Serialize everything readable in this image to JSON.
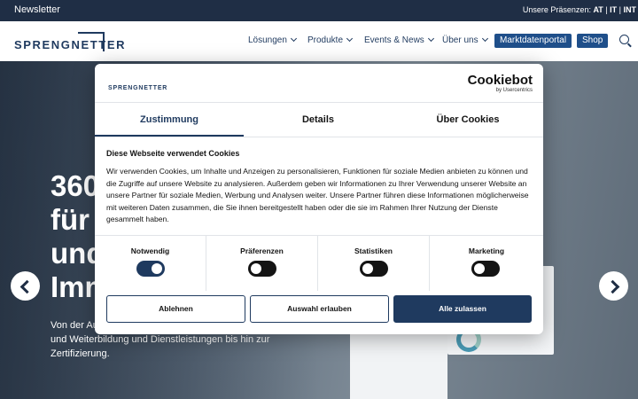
{
  "topbar": {
    "newsletter": "Newsletter",
    "presence_label": "Unsere Präsenzen:",
    "presence_links": [
      "AT",
      "IT",
      "INT"
    ]
  },
  "header": {
    "logo": "SPRENGNETTER",
    "nav": [
      "Lösungen",
      "Produkte",
      "Events & News",
      "Über uns"
    ],
    "buttons": [
      "Marktdatenportal",
      "Shop"
    ]
  },
  "hero": {
    "headline_lines": [
      "360",
      "für",
      "und",
      "Imm"
    ],
    "subtext_lines": [
      "Von der Au",
      "und Weiterbildung und Dienstleistungen bis hin zur",
      "Zertifizierung."
    ]
  },
  "cookie_dialog": {
    "logo": "SPRENGNETTER",
    "brand": "Cookiebot",
    "brand_sub": "by Usercentrics",
    "tabs": [
      "Zustimmung",
      "Details",
      "Über Cookies"
    ],
    "active_tab": "Zustimmung",
    "heading": "Diese Webseite verwendet Cookies",
    "body": "Wir verwenden Cookies, um Inhalte und Anzeigen zu personalisieren, Funktionen für soziale Medien anbieten zu können und die Zugriffe auf unsere Website zu analysieren. Außerdem geben wir Informationen zu Ihrer Verwendung unserer Website an unsere Partner für soziale Medien, Werbung und Analysen weiter. Unsere Partner führen diese Informationen möglicherweise mit weiteren Daten zusammen, die Sie ihnen bereitgestellt haben oder die sie im Rahmen Ihrer Nutzung der Dienste gesammelt haben.",
    "preferences": [
      {
        "label": "Notwendig",
        "enabled": true
      },
      {
        "label": "Präferenzen",
        "enabled": false
      },
      {
        "label": "Statistiken",
        "enabled": false
      },
      {
        "label": "Marketing",
        "enabled": false
      }
    ],
    "buttons": {
      "reject": "Ablehnen",
      "allow_selection": "Auswahl erlauben",
      "allow_all": "Alle zulassen"
    }
  },
  "colors": {
    "brand_navy": "#1f3a5f",
    "topbar_bg": "#1f2e45",
    "button_blue": "#1f4f8a"
  }
}
